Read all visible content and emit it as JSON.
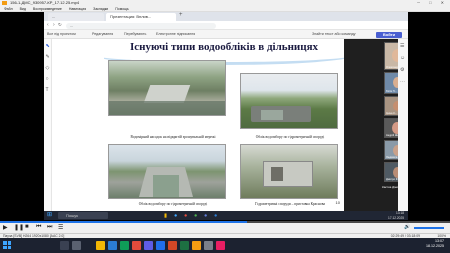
{
  "window": {
    "title": "156-1-ДМС_930957-КР_17.12.25.mp4",
    "controls": "─ □ ✕"
  },
  "menu": [
    "Файл",
    "Вид",
    "Воспроизведение",
    "Навигация",
    "Закладки",
    "Помощь"
  ],
  "browser": {
    "tab_active": "Презентация: Вплив...",
    "tab_second": "...",
    "url": "...",
    "page_bar": {
      "left": "Все під проектом",
      "item2": "Редагування",
      "item3": "Перебувають",
      "item4": "Електронне підписання",
      "right": "Знайти текст або команду",
      "join": "Войти"
    }
  },
  "slide": {
    "title": "Існуючі типи водообліків в дільницях",
    "captions": {
      "c1": "Водомірний насадок на відкритій зрошувальній мережі",
      "c2": "Облік водозабору по гідрометричній споруді",
      "c3": "Облік водозабору по гідрометричній споруді",
      "c4": "Гідрометричні споруди – приставка Краснова"
    },
    "page_number": "10"
  },
  "participants": [
    {
      "name": "Олександр Бро..."
    },
    {
      "name": "Юлія П..."
    },
    {
      "name": "Ірина К..."
    },
    {
      "name": "Андрій Шевч..."
    },
    {
      "name": "Людмила Т..."
    },
    {
      "name": "Дмитро Ф..."
    }
  ],
  "side_label": "Кастка Дмитро",
  "inner_taskbar": {
    "search": "Пошук",
    "time": "13:18",
    "date": "17.12.2025"
  },
  "player": {
    "elapsed": "02:29:49 / 03:18:09",
    "status_left": "Пауза  [SVB]  H264 1920x1080  [AAC 2.0]",
    "zoom": "100%"
  },
  "taskbar": {
    "time": "13:07",
    "date": "18.12.2025"
  },
  "colors": {
    "accent": "#1e73e8",
    "join": "#4a5fd1",
    "title": "#1a1a40"
  }
}
